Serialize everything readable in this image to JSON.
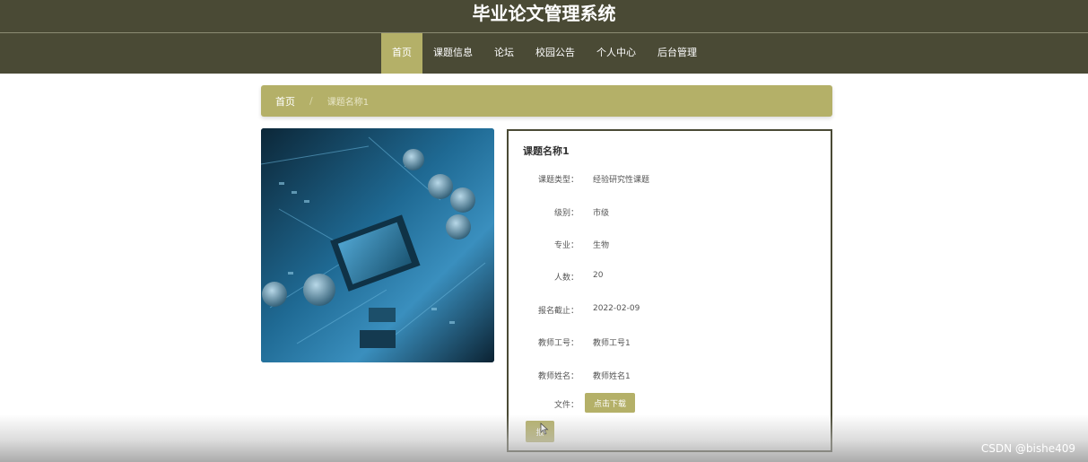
{
  "header": {
    "site_title": "毕业论文管理系统"
  },
  "nav": {
    "items": [
      {
        "label": "首页",
        "active": true
      },
      {
        "label": "课题信息",
        "active": false
      },
      {
        "label": "论坛",
        "active": false
      },
      {
        "label": "校园公告",
        "active": false
      },
      {
        "label": "个人中心",
        "active": false
      },
      {
        "label": "后台管理",
        "active": false
      }
    ]
  },
  "breadcrumb": {
    "home": "首页",
    "separator": "/",
    "current": "课题名称1"
  },
  "detail": {
    "title": "课题名称1",
    "fields": [
      {
        "label": "课题类型：",
        "value": "经验研究性课题"
      },
      {
        "label": "级别：",
        "value": "市级"
      },
      {
        "label": "专业：",
        "value": "生物"
      },
      {
        "label": "人数：",
        "value": "20"
      },
      {
        "label": "报名截止：",
        "value": "2022-02-09"
      },
      {
        "label": "教师工号：",
        "value": "教师工号1"
      },
      {
        "label": "教师姓名：",
        "value": "教师姓名1"
      },
      {
        "label": "文件：",
        "value": ""
      }
    ],
    "download_label": "点击下载",
    "apply_label": "报"
  },
  "image": {
    "subject": "circuit-board-photo"
  },
  "watermark": "CSDN @bishe409",
  "colors": {
    "header_bg": "#4a4a35",
    "accent": "#b4b068",
    "panel_border": "#4a4a35"
  }
}
